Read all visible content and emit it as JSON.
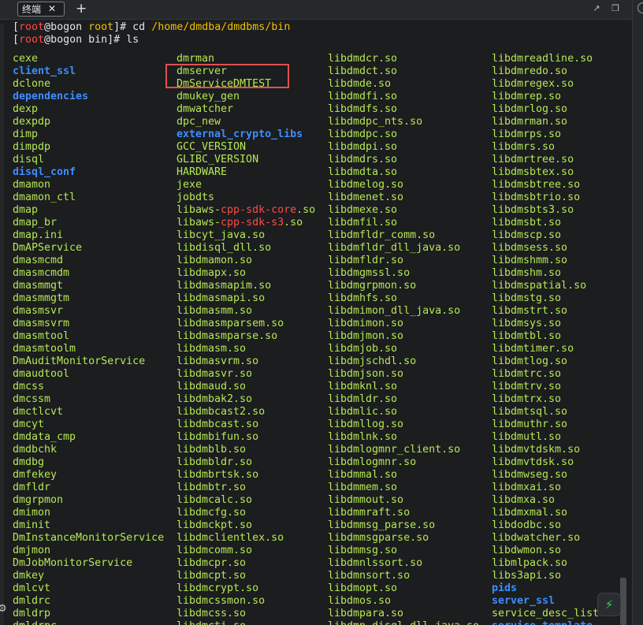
{
  "tab": {
    "label": "终端",
    "close": "✕",
    "add": "+"
  },
  "toolbar": {
    "external_icon": "↗",
    "restore_icon": "❐",
    "rail_icon": "circle-icon"
  },
  "prompt": {
    "line1": {
      "open": "[",
      "user": "root",
      "at": "@",
      "host": "bogon",
      "space": " ",
      "dir": "root",
      "close": "]# ",
      "command": "cd ",
      "arg": "/home/dmdba/dmdbms/bin"
    },
    "line2": {
      "open": "[",
      "user": "root",
      "at": "@",
      "host": "bogon",
      "space": " ",
      "dir": "bin",
      "close": "]# ",
      "command": "ls"
    }
  },
  "columns": [
    [
      {
        "t": "cexe",
        "k": "file"
      },
      {
        "t": "client_ssl",
        "k": "dir"
      },
      {
        "t": "dclone",
        "k": "file"
      },
      {
        "t": "dependencies",
        "k": "dir"
      },
      {
        "t": "dexp",
        "k": "file"
      },
      {
        "t": "dexpdp",
        "k": "file"
      },
      {
        "t": "dimp",
        "k": "file"
      },
      {
        "t": "dimpdp",
        "k": "file"
      },
      {
        "t": "disql",
        "k": "file"
      },
      {
        "t": "disql_conf",
        "k": "dir"
      },
      {
        "t": "dmamon",
        "k": "file"
      },
      {
        "t": "dmamon_ctl",
        "k": "file"
      },
      {
        "t": "dmap",
        "k": "file"
      },
      {
        "t": "dmap_br",
        "k": "file"
      },
      {
        "t": "dmap.ini",
        "k": "file"
      },
      {
        "t": "DmAPService",
        "k": "file"
      },
      {
        "t": "dmasmcmd",
        "k": "file"
      },
      {
        "t": "dmasmcmdm",
        "k": "file"
      },
      {
        "t": "dmasmmgt",
        "k": "file"
      },
      {
        "t": "dmasmmgtm",
        "k": "file"
      },
      {
        "t": "dmasmsvr",
        "k": "file"
      },
      {
        "t": "dmasmsvrm",
        "k": "file"
      },
      {
        "t": "dmasmtool",
        "k": "file"
      },
      {
        "t": "dmasmtoolm",
        "k": "file"
      },
      {
        "t": "DmAuditMonitorService",
        "k": "file"
      },
      {
        "t": "dmaudtool",
        "k": "file"
      },
      {
        "t": "dmcss",
        "k": "file"
      },
      {
        "t": "dmcssm",
        "k": "file"
      },
      {
        "t": "dmctlcvt",
        "k": "file"
      },
      {
        "t": "dmcyt",
        "k": "file"
      },
      {
        "t": "dmdata_cmp",
        "k": "file"
      },
      {
        "t": "dmdbchk",
        "k": "file"
      },
      {
        "t": "dmdbg",
        "k": "file"
      },
      {
        "t": "dmfekey",
        "k": "file"
      },
      {
        "t": "dmfldr",
        "k": "file"
      },
      {
        "t": "dmgrpmon",
        "k": "file"
      },
      {
        "t": "dmimon",
        "k": "file"
      },
      {
        "t": "dminit",
        "k": "file"
      },
      {
        "t": "DmInstanceMonitorService",
        "k": "file"
      },
      {
        "t": "dmjmon",
        "k": "file"
      },
      {
        "t": "DmJobMonitorService",
        "k": "file"
      },
      {
        "t": "dmkey",
        "k": "file"
      },
      {
        "t": "dmlcvt",
        "k": "file"
      },
      {
        "t": "dmldrc",
        "k": "file"
      },
      {
        "t": "dmldrp",
        "k": "file"
      },
      {
        "t": "dmldrpc",
        "k": "file"
      }
    ],
    [
      {
        "t": "dmrman",
        "k": "file"
      },
      {
        "t": "dmserver",
        "k": "file"
      },
      {
        "t": "DmServiceDMTEST",
        "k": "file"
      },
      {
        "t": "dmukey_gen",
        "k": "file"
      },
      {
        "t": "dmwatcher",
        "k": "file"
      },
      {
        "t": "dpc_new",
        "k": "file"
      },
      {
        "t": "external_crypto_libs",
        "k": "dir"
      },
      {
        "t": "GCC_VERSION",
        "k": "file"
      },
      {
        "t": "GLIBC_VERSION",
        "k": "file"
      },
      {
        "t": "HARDWARE",
        "k": "file"
      },
      {
        "t": "jexe",
        "k": "file"
      },
      {
        "t": "jobdts",
        "k": "file"
      },
      {
        "t": "libaws-cpp-sdk-core.so",
        "k": "split",
        "a": "libaws-",
        "b": "cpp-sdk-core",
        "c": ".so"
      },
      {
        "t": "libaws-cpp-sdk-s3.so",
        "k": "split",
        "a": "libaws-",
        "b": "cpp-sdk-s3",
        "c": ".so"
      },
      {
        "t": "libcyt_java.so",
        "k": "file"
      },
      {
        "t": "libdisql_dll.so",
        "k": "file"
      },
      {
        "t": "libdmamon.so",
        "k": "file"
      },
      {
        "t": "libdmapx.so",
        "k": "file"
      },
      {
        "t": "libdmasmapim.so",
        "k": "file"
      },
      {
        "t": "libdmasmapi.so",
        "k": "file"
      },
      {
        "t": "libdmasmm.so",
        "k": "file"
      },
      {
        "t": "libdmasmparsem.so",
        "k": "file"
      },
      {
        "t": "libdmasmparse.so",
        "k": "file"
      },
      {
        "t": "libdmasm.so",
        "k": "file"
      },
      {
        "t": "libdmasvrm.so",
        "k": "file"
      },
      {
        "t": "libdmasvr.so",
        "k": "file"
      },
      {
        "t": "libdmaud.so",
        "k": "file"
      },
      {
        "t": "libdmbak2.so",
        "k": "file"
      },
      {
        "t": "libdmbcast2.so",
        "k": "file"
      },
      {
        "t": "libdmbcast.so",
        "k": "file"
      },
      {
        "t": "libdmbifun.so",
        "k": "file"
      },
      {
        "t": "libdmblb.so",
        "k": "file"
      },
      {
        "t": "libdmbldr.so",
        "k": "file"
      },
      {
        "t": "libdmbrtsk.so",
        "k": "file"
      },
      {
        "t": "libdmbtr.so",
        "k": "file"
      },
      {
        "t": "libdmcalc.so",
        "k": "file"
      },
      {
        "t": "libdmcfg.so",
        "k": "file"
      },
      {
        "t": "libdmckpt.so",
        "k": "file"
      },
      {
        "t": "libdmclientlex.so",
        "k": "file"
      },
      {
        "t": "libdmcomm.so",
        "k": "file"
      },
      {
        "t": "libdmcpr.so",
        "k": "file"
      },
      {
        "t": "libdmcpt.so",
        "k": "file"
      },
      {
        "t": "libdmcrypt.so",
        "k": "file"
      },
      {
        "t": "libdmcssmon.so",
        "k": "file"
      },
      {
        "t": "libdmcss.so",
        "k": "file"
      },
      {
        "t": "libdmcti.so",
        "k": "file"
      }
    ],
    [
      {
        "t": "libdmdcr.so",
        "k": "file"
      },
      {
        "t": "libdmdct.so",
        "k": "file"
      },
      {
        "t": "libdmde.so",
        "k": "file"
      },
      {
        "t": "libdmdfi.so",
        "k": "file"
      },
      {
        "t": "libdmdfs.so",
        "k": "file"
      },
      {
        "t": "libdmdpc_nts.so",
        "k": "file"
      },
      {
        "t": "libdmdpc.so",
        "k": "file"
      },
      {
        "t": "libdmdpi.so",
        "k": "file"
      },
      {
        "t": "libdmdrs.so",
        "k": "file"
      },
      {
        "t": "libdmdta.so",
        "k": "file"
      },
      {
        "t": "libdmelog.so",
        "k": "file"
      },
      {
        "t": "libdmenet.so",
        "k": "file"
      },
      {
        "t": "libdmexe.so",
        "k": "file"
      },
      {
        "t": "libdmfil.so",
        "k": "file"
      },
      {
        "t": "libdmfldr_comm.so",
        "k": "file"
      },
      {
        "t": "libdmfldr_dll_java.so",
        "k": "file"
      },
      {
        "t": "libdmfldr.so",
        "k": "file"
      },
      {
        "t": "libdmgmssl.so",
        "k": "file"
      },
      {
        "t": "libdmgrpmon.so",
        "k": "file"
      },
      {
        "t": "libdmhfs.so",
        "k": "file"
      },
      {
        "t": "libdmimon_dll_java.so",
        "k": "file"
      },
      {
        "t": "libdmimon.so",
        "k": "file"
      },
      {
        "t": "libdmjmon.so",
        "k": "file"
      },
      {
        "t": "libdmjob.so",
        "k": "file"
      },
      {
        "t": "libdmjschdl.so",
        "k": "file"
      },
      {
        "t": "libdmjson.so",
        "k": "file"
      },
      {
        "t": "libdmknl.so",
        "k": "file"
      },
      {
        "t": "libdmldr.so",
        "k": "file"
      },
      {
        "t": "libdmlic.so",
        "k": "file"
      },
      {
        "t": "libdmllog.so",
        "k": "file"
      },
      {
        "t": "libdmlnk.so",
        "k": "file"
      },
      {
        "t": "libdmlogmnr_client.so",
        "k": "file"
      },
      {
        "t": "libdmlogmnr.so",
        "k": "file"
      },
      {
        "t": "libdmmal.so",
        "k": "file"
      },
      {
        "t": "libdmmem.so",
        "k": "file"
      },
      {
        "t": "libdmmout.so",
        "k": "file"
      },
      {
        "t": "libdmmraft.so",
        "k": "file"
      },
      {
        "t": "libdmmsg_parse.so",
        "k": "file"
      },
      {
        "t": "libdmmsgparse.so",
        "k": "file"
      },
      {
        "t": "libdmmsg.so",
        "k": "file"
      },
      {
        "t": "libdmnlssort.so",
        "k": "file"
      },
      {
        "t": "libdmnsort.so",
        "k": "file"
      },
      {
        "t": "libdmopt.so",
        "k": "file"
      },
      {
        "t": "libdmos.so",
        "k": "file"
      },
      {
        "t": "libdmpara.so",
        "k": "file"
      },
      {
        "t": "libdmp_disql_dll_java.so",
        "k": "file"
      }
    ],
    [
      {
        "t": "libdmreadline.so",
        "k": "file"
      },
      {
        "t": "libdmredo.so",
        "k": "file"
      },
      {
        "t": "libdmregex.so",
        "k": "file"
      },
      {
        "t": "libdmrep.so",
        "k": "file"
      },
      {
        "t": "libdmrlog.so",
        "k": "file"
      },
      {
        "t": "libdmrman.so",
        "k": "file"
      },
      {
        "t": "libdmrps.so",
        "k": "file"
      },
      {
        "t": "libdmrs.so",
        "k": "file"
      },
      {
        "t": "libdmrtree.so",
        "k": "file"
      },
      {
        "t": "libdmsbtex.so",
        "k": "file"
      },
      {
        "t": "libdmsbtree.so",
        "k": "file"
      },
      {
        "t": "libdmsbtrio.so",
        "k": "file"
      },
      {
        "t": "libdmsbts3.so",
        "k": "file"
      },
      {
        "t": "libdmsbt.so",
        "k": "file"
      },
      {
        "t": "libdmscp.so",
        "k": "file"
      },
      {
        "t": "libdmsess.so",
        "k": "file"
      },
      {
        "t": "libdmshmm.so",
        "k": "file"
      },
      {
        "t": "libdmshm.so",
        "k": "file"
      },
      {
        "t": "libdmspatial.so",
        "k": "file"
      },
      {
        "t": "libdmstg.so",
        "k": "file"
      },
      {
        "t": "libdmstrt.so",
        "k": "file"
      },
      {
        "t": "libdmsys.so",
        "k": "file"
      },
      {
        "t": "libdmtbl.so",
        "k": "file"
      },
      {
        "t": "libdmtimer.so",
        "k": "file"
      },
      {
        "t": "libdmtlog.so",
        "k": "file"
      },
      {
        "t": "libdmtrc.so",
        "k": "file"
      },
      {
        "t": "libdmtrv.so",
        "k": "file"
      },
      {
        "t": "libdmtrx.so",
        "k": "file"
      },
      {
        "t": "libdmtsql.so",
        "k": "file"
      },
      {
        "t": "libdmuthr.so",
        "k": "file"
      },
      {
        "t": "libdmutl.so",
        "k": "file"
      },
      {
        "t": "libdmvtdskm.so",
        "k": "file"
      },
      {
        "t": "libdmvtdsk.so",
        "k": "file"
      },
      {
        "t": "libdmwseg.so",
        "k": "file"
      },
      {
        "t": "libdmxai.so",
        "k": "file"
      },
      {
        "t": "libdmxa.so",
        "k": "file"
      },
      {
        "t": "libdmxmal.so",
        "k": "file"
      },
      {
        "t": "libdodbc.so",
        "k": "file"
      },
      {
        "t": "libdwatcher.so",
        "k": "file"
      },
      {
        "t": "libdwmon.so",
        "k": "file"
      },
      {
        "t": "libmlpack.so",
        "k": "file"
      },
      {
        "t": "libs3api.so",
        "k": "file"
      },
      {
        "t": "pids",
        "k": "dir"
      },
      {
        "t": "server_ssl",
        "k": "dir"
      },
      {
        "t": "service_desc_list",
        "k": "file"
      },
      {
        "t": "service_template",
        "k": "dir"
      }
    ]
  ],
  "colors": {
    "background": "#1b1d1f",
    "file": "#b5e853",
    "dir": "#3c8eff",
    "red": "#ff4a4a",
    "path": "#f0c000",
    "highlight": "#e05050"
  },
  "floating_button": {
    "icon": "flash-icon",
    "glyph": "⚡"
  }
}
